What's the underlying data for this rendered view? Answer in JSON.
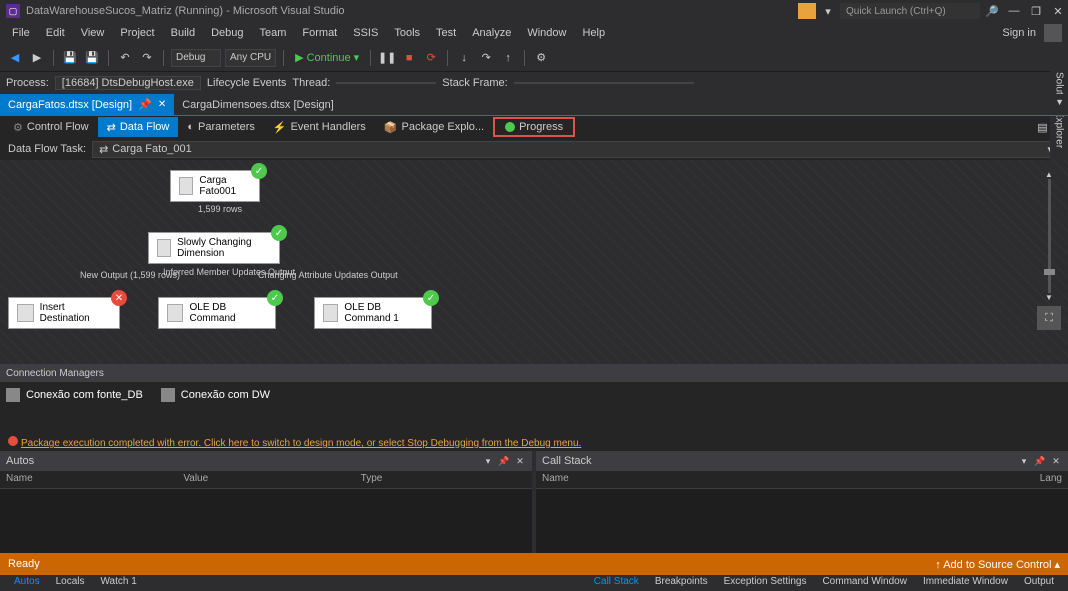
{
  "title": "DataWarehouseSucos_Matriz (Running) - Microsoft Visual Studio",
  "quickLaunch": "Quick Launch (Ctrl+Q)",
  "menu": [
    "File",
    "Edit",
    "View",
    "Project",
    "Build",
    "Debug",
    "Team",
    "Format",
    "SSIS",
    "Tools",
    "Test",
    "Analyze",
    "Window",
    "Help"
  ],
  "signIn": "Sign in",
  "toolbar": {
    "config": "Debug",
    "platform": "Any CPU",
    "continue": "Continue"
  },
  "process": {
    "label": "Process:",
    "name": "[16684] DtsDebugHost.exe",
    "lifecycle": "Lifecycle Events",
    "thread": "Thread:",
    "stack": "Stack Frame:"
  },
  "docTabs": [
    {
      "label": "CargaFatos.dtsx [Design]",
      "active": true
    },
    {
      "label": "CargaDimensoes.dtsx [Design]",
      "active": false
    }
  ],
  "designTabs": {
    "controlFlow": "Control Flow",
    "dataFlow": "Data Flow",
    "parameters": "Parameters",
    "eventHandlers": "Event Handlers",
    "packageExplorer": "Package Explo...",
    "progress": "Progress"
  },
  "dataFlowTask": {
    "label": "Data Flow Task:",
    "value": "Carga Fato_001"
  },
  "nodes": {
    "source": "Carga Fato001",
    "scd": "Slowly Changing Dimension",
    "insert": "Insert Destination",
    "cmd1": "OLE DB Command",
    "cmd2": "OLE DB Command 1"
  },
  "edges": {
    "rows": "1,599 rows",
    "newOutput": "New Output (1,599 rows)",
    "inferred": "Inferred Member Updates Output",
    "changing": "Changing Attribute Updates Output"
  },
  "connManagers": {
    "title": "Connection Managers",
    "c1": "Conexão com fonte_DB",
    "c2": "Conexão com DW"
  },
  "errorLine": "Package execution completed with error. Click here to switch to design mode, or select Stop Debugging from the Debug menu.",
  "autos": {
    "title": "Autos",
    "cols": [
      "Name",
      "Value",
      "Type"
    ]
  },
  "callStack": {
    "title": "Call Stack",
    "cols": [
      "Name",
      "Lang"
    ]
  },
  "autosTabs": [
    "Autos",
    "Locals",
    "Watch 1"
  ],
  "stackTabs": [
    "Call Stack",
    "Breakpoints",
    "Exception Settings",
    "Command Window",
    "Immediate Window",
    "Output"
  ],
  "status": {
    "ready": "Ready",
    "add": "Add to Source Control"
  },
  "rightRail": [
    "Solution Explorer",
    "Team Explorer"
  ]
}
